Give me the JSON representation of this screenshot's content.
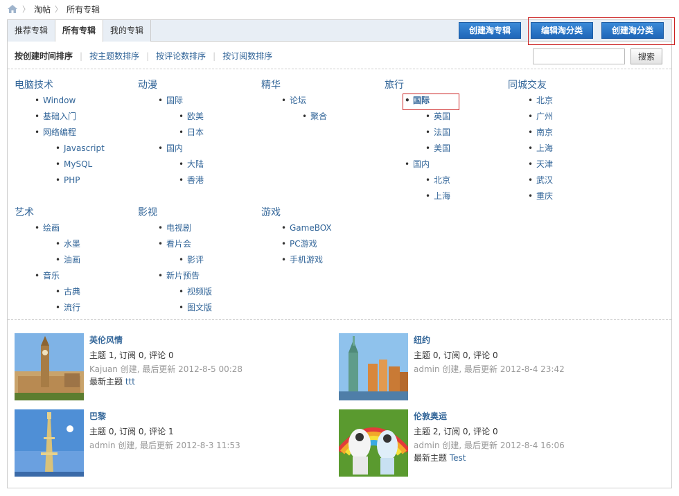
{
  "breadcrumb": {
    "items": [
      "淘帖",
      "所有专辑"
    ]
  },
  "tabs": [
    {
      "label": "推荐专辑",
      "active": false
    },
    {
      "label": "所有专辑",
      "active": true
    },
    {
      "label": "我的专辑",
      "active": false
    }
  ],
  "actions": {
    "create_album": "创建淘专辑",
    "edit_category": "编辑淘分类",
    "create_category": "创建淘分类"
  },
  "sort": {
    "options": [
      "按创建时间排序",
      "按主题数排序",
      "按评论数排序",
      "按订阅数排序"
    ],
    "current": 0
  },
  "search": {
    "value": "",
    "button": "搜索"
  },
  "categories": [
    {
      "title": "电脑技术",
      "items": [
        {
          "label": "Window",
          "level": 1
        },
        {
          "label": "基础入门",
          "level": 1
        },
        {
          "label": "网络编程",
          "level": 1
        },
        {
          "label": "Javascript",
          "level": 2
        },
        {
          "label": "MySQL",
          "level": 2
        },
        {
          "label": "PHP",
          "level": 2
        }
      ]
    },
    {
      "title": "动漫",
      "items": [
        {
          "label": "国际",
          "level": 1
        },
        {
          "label": "欧美",
          "level": 2
        },
        {
          "label": "日本",
          "level": 2
        },
        {
          "label": "国内",
          "level": 1
        },
        {
          "label": "大陆",
          "level": 2
        },
        {
          "label": "香港",
          "level": 2
        }
      ]
    },
    {
      "title": "精华",
      "items": [
        {
          "label": "论坛",
          "level": 1
        },
        {
          "label": "聚合",
          "level": 2
        }
      ]
    },
    {
      "title": "旅行",
      "items": [
        {
          "label": "国际",
          "level": 1,
          "selected": true
        },
        {
          "label": "英国",
          "level": 2
        },
        {
          "label": "法国",
          "level": 2
        },
        {
          "label": "美国",
          "level": 2
        },
        {
          "label": "国内",
          "level": 1
        },
        {
          "label": "北京",
          "level": 2
        },
        {
          "label": "上海",
          "level": 2
        }
      ]
    },
    {
      "title": "同城交友",
      "items": [
        {
          "label": "北京",
          "level": 1
        },
        {
          "label": "广州",
          "level": 1
        },
        {
          "label": "南京",
          "level": 1
        },
        {
          "label": "上海",
          "level": 1
        },
        {
          "label": "天津",
          "level": 1
        },
        {
          "label": "武汉",
          "level": 1
        },
        {
          "label": "重庆",
          "level": 1
        }
      ]
    },
    {
      "title": "艺术",
      "items": [
        {
          "label": "绘画",
          "level": 1
        },
        {
          "label": "水墨",
          "level": 2
        },
        {
          "label": "油画",
          "level": 2
        },
        {
          "label": "音乐",
          "level": 1
        },
        {
          "label": "古典",
          "level": 2
        },
        {
          "label": "流行",
          "level": 2
        }
      ]
    },
    {
      "title": "影视",
      "items": [
        {
          "label": "电视剧",
          "level": 1
        },
        {
          "label": "看片会",
          "level": 1
        },
        {
          "label": "影评",
          "level": 2
        },
        {
          "label": "新片预告",
          "level": 1
        },
        {
          "label": "视频版",
          "level": 2
        },
        {
          "label": "图文版",
          "level": 2
        }
      ]
    },
    {
      "title": "游戏",
      "items": [
        {
          "label": "GameBOX",
          "level": 1
        },
        {
          "label": "PC游戏",
          "level": 1
        },
        {
          "label": "手机游戏",
          "level": 1
        }
      ]
    }
  ],
  "albums": [
    {
      "title": "英伦风情",
      "stats": "主题 1, 订阅 0, 评论 0",
      "meta": "Kajuan 创建, 最后更新 2012-8-5 00:28",
      "latest_label": "最新主题",
      "latest_topic": "ttt"
    },
    {
      "title": "纽约",
      "stats": "主题 0, 订阅 0, 评论 0",
      "meta": "admin 创建, 最后更新 2012-8-4 23:42"
    },
    {
      "title": "巴黎",
      "stats": "主题 0, 订阅 0, 评论 1",
      "meta": "admin 创建, 最后更新 2012-8-3 11:53"
    },
    {
      "title": "伦敦奥运",
      "stats": "主题 2, 订阅 0, 评论 0",
      "meta": "admin 创建, 最后更新 2012-8-4 16:06",
      "latest_label": "最新主题",
      "latest_topic": "Test"
    }
  ]
}
